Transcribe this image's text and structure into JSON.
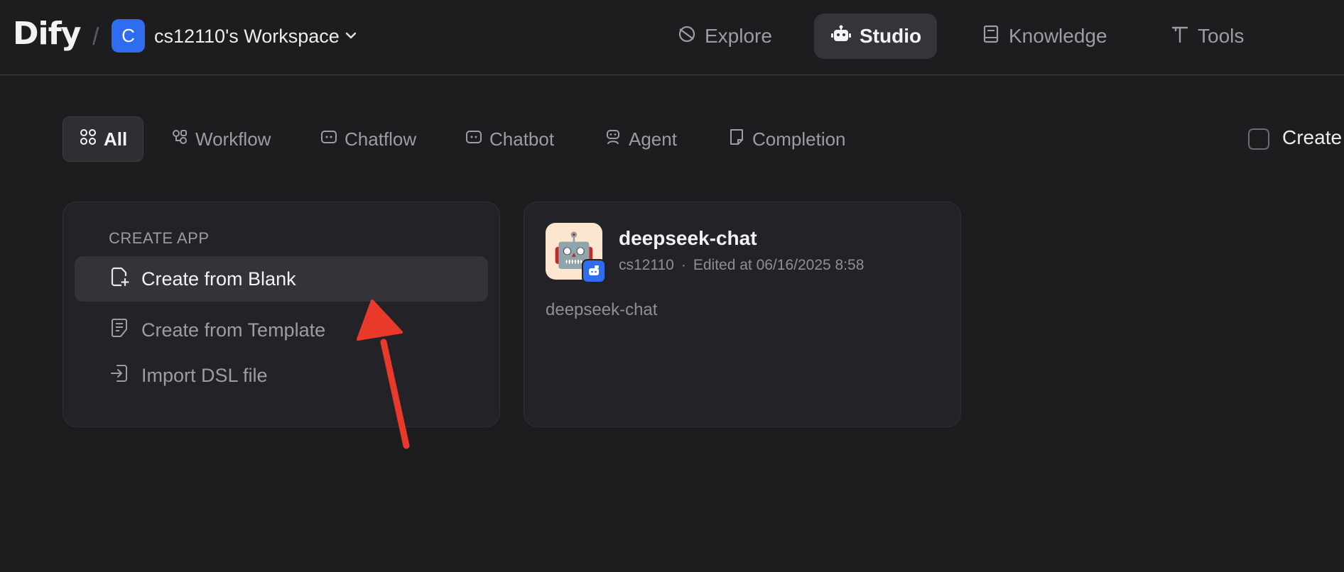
{
  "header": {
    "logo": "Dify",
    "separator": "/",
    "workspace_initial": "C",
    "workspace_name": "cs12110's Workspace",
    "nav": [
      {
        "label": "Explore",
        "icon": "compass-icon",
        "active": false
      },
      {
        "label": "Studio",
        "icon": "robot-icon",
        "active": true
      },
      {
        "label": "Knowledge",
        "icon": "book-icon",
        "active": false
      },
      {
        "label": "Tools",
        "icon": "tool-icon",
        "active": false
      }
    ]
  },
  "filters": {
    "tabs": [
      {
        "label": "All",
        "icon": "grid-icon",
        "active": true
      },
      {
        "label": "Workflow",
        "icon": "workflow-icon",
        "active": false
      },
      {
        "label": "Chatflow",
        "icon": "chatflow-icon",
        "active": false
      },
      {
        "label": "Chatbot",
        "icon": "chatbot-icon",
        "active": false
      },
      {
        "label": "Agent",
        "icon": "agent-icon",
        "active": false
      },
      {
        "label": "Completion",
        "icon": "completion-icon",
        "active": false
      }
    ],
    "created_by_me_label": "Create"
  },
  "create_app": {
    "heading": "CREATE APP",
    "items": [
      {
        "label": "Create from Blank",
        "icon": "file-plus-icon"
      },
      {
        "label": "Create from Template",
        "icon": "template-icon"
      },
      {
        "label": "Import DSL file",
        "icon": "import-icon"
      }
    ]
  },
  "apps": [
    {
      "name": "deepseek-chat",
      "emoji": "🤖",
      "author": "cs12110",
      "dot": "·",
      "edited": "Edited at 06/16/2025 8:58",
      "description": "deepseek-chat",
      "badge_icon": "chatbot-badge-icon"
    }
  ],
  "colors": {
    "background": "#1d1d20",
    "accent": "#2f6cf0",
    "annotation_arrow": "#e8392a",
    "app_icon_bg": "#fde6cf"
  }
}
